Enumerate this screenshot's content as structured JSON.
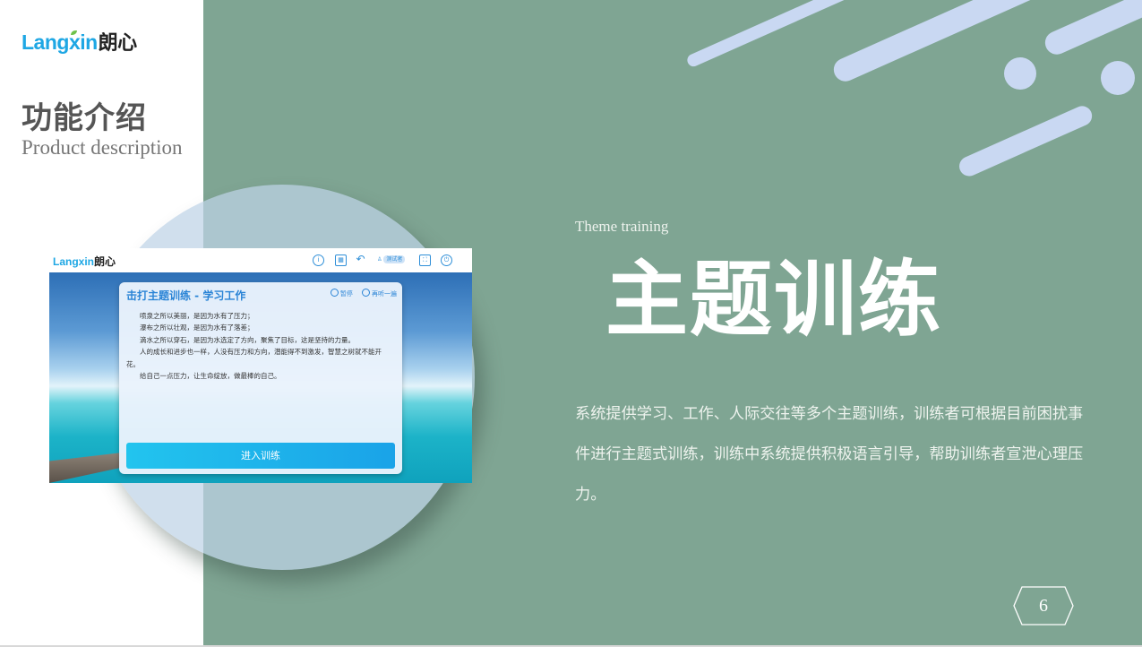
{
  "brand": {
    "latin": "Langxin",
    "cn": "朗心"
  },
  "heading": {
    "cn": "功能介绍",
    "en": "Product description"
  },
  "screenshot": {
    "brand_latin": "Langxin",
    "brand_cn": "朗心",
    "user_label": "测试者",
    "card_title": "击打主题训练 - 学习工作",
    "pause_label": "暂停",
    "replay_label": "再听一遍",
    "paragraphs": [
      "喷泉之所以美丽，是因为水有了压力；",
      "瀑布之所以壮观，是因为水有了落差；",
      "滴水之所以穿石，是因为水选定了方向，聚焦了目标，这是坚持的力量。",
      "人的成长和进步也一样，人没有压力和方向，潜能得不到激发，智慧之树就不能开花。",
      "给自己一点压力，让生命绽放，做最棒的自己。"
    ],
    "enter_button": "进入训练"
  },
  "section": {
    "eyebrow": "Theme training",
    "title": "主题训练",
    "description": "系统提供学习、工作、人际交往等多个主题训练，训练者可根据目前困扰事件进行主题式训练，训练中系统提供积极语言引导，帮助训练者宣泄心理压力。"
  },
  "page_number": "6",
  "colors": {
    "panel": "#7fa593",
    "accent": "#1ea7e4",
    "decor": "#c9d8f2"
  }
}
